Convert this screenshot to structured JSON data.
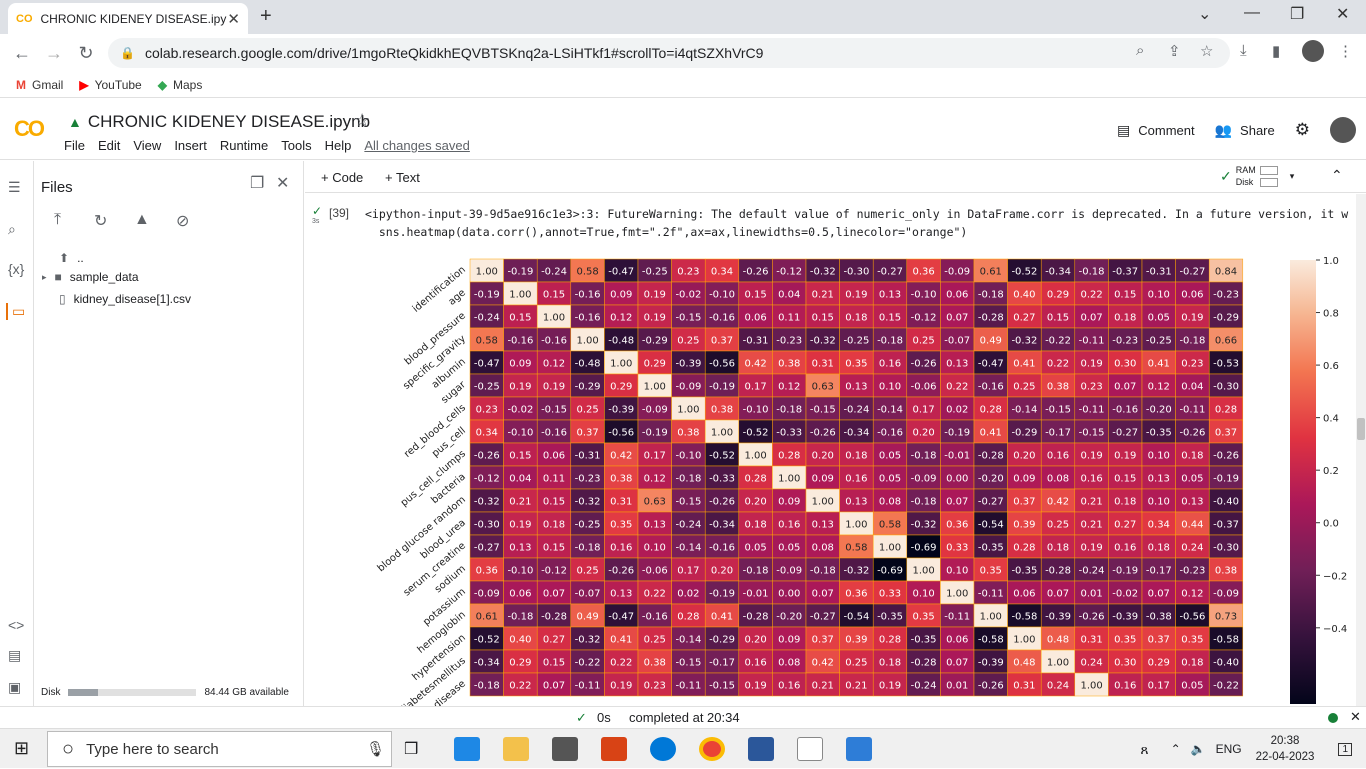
{
  "browser": {
    "tab_title": "CHRONIC KIDENEY DISEASE.ipynb",
    "tab_logo": "CO",
    "url": "colab.research.google.com/drive/1mgoRteQkidkhEQVBTSKnq2a-LSiHTkf1#scrollTo=i4qtSZXhVrC9",
    "bookmarks": [
      {
        "label": "Gmail",
        "icon": "M",
        "color": "#ea4335"
      },
      {
        "label": "YouTube",
        "icon": "▶",
        "color": "#ff0000"
      },
      {
        "label": "Maps",
        "icon": "◆",
        "color": "#34a853"
      }
    ]
  },
  "colab": {
    "logo": "CO",
    "notebook_title": "CHRONIC KIDENEY DISEASE.ipynb",
    "menu": [
      "File",
      "Edit",
      "View",
      "Insert",
      "Runtime",
      "Tools",
      "Help"
    ],
    "save_status": "All changes saved",
    "comment_label": "Comment",
    "share_label": "Share",
    "toolbar": {
      "code_label": "+ Code",
      "text_label": "+ Text",
      "ram_label": "RAM",
      "disk_label": "Disk"
    }
  },
  "files_panel": {
    "title": "Files",
    "tree": [
      {
        "label": "..",
        "type": "up"
      },
      {
        "label": "sample_data",
        "type": "folder"
      },
      {
        "label": "kidney_disease[1].csv",
        "type": "file"
      }
    ],
    "disk_label": "Disk",
    "disk_available": "84.44 GB available",
    "disk_used_fraction": 0.23
  },
  "cell": {
    "exec_count": "[39]",
    "run_time": "3s",
    "warning_line1": "<ipython-input-39-9d5ae916c1e3>:3: FutureWarning: The default value of numeric_only in DataFrame.corr is deprecated. In a future version, it w:",
    "warning_line2": "  sns.heatmap(data.corr(),annot=True,fmt=\".2f\",ax=ax,linewidths=0.5,linecolor=\"orange\")"
  },
  "chart_data": {
    "type": "heatmap",
    "title": "",
    "row_labels": [
      "identification",
      "age",
      "blood_pressure",
      "specific_gravity",
      "albumin",
      "sugar",
      "red_blood_cells",
      "pus_cell",
      "pus_cell_clumps",
      "bacteria",
      "blood glucose random",
      "blood_urea",
      "serum_creatine",
      "sodium",
      "potassium",
      "hemoglobin",
      "hypertension",
      "diabetesmellitus",
      "coronary_artery_disease"
    ],
    "matrix": [
      [
        1.0,
        -0.19,
        -0.24,
        0.58,
        -0.47,
        -0.25,
        0.23,
        0.34,
        -0.26,
        -0.12,
        -0.32,
        -0.3,
        -0.27,
        0.36,
        -0.09,
        0.61,
        -0.52,
        -0.34,
        -0.18,
        -0.37,
        -0.31,
        -0.27,
        0.84
      ],
      [
        -0.19,
        1.0,
        0.15,
        -0.16,
        0.09,
        0.19,
        -0.02,
        -0.1,
        0.15,
        0.04,
        0.21,
        0.19,
        0.13,
        -0.1,
        0.06,
        -0.18,
        0.4,
        0.29,
        0.22,
        0.15,
        0.1,
        0.06,
        -0.23
      ],
      [
        -0.24,
        0.15,
        1.0,
        -0.16,
        0.12,
        0.19,
        -0.15,
        -0.16,
        0.06,
        0.11,
        0.15,
        0.18,
        0.15,
        -0.12,
        0.07,
        -0.28,
        0.27,
        0.15,
        0.07,
        0.18,
        0.05,
        0.19,
        -0.29
      ],
      [
        0.58,
        -0.16,
        -0.16,
        1.0,
        -0.48,
        -0.29,
        0.25,
        0.37,
        -0.31,
        -0.23,
        -0.32,
        -0.25,
        -0.18,
        0.25,
        -0.07,
        0.49,
        -0.32,
        -0.22,
        -0.11,
        -0.23,
        -0.25,
        -0.18,
        0.66
      ],
      [
        -0.47,
        0.09,
        0.12,
        -0.48,
        1.0,
        0.29,
        -0.39,
        -0.56,
        0.42,
        0.38,
        0.31,
        0.35,
        0.16,
        -0.26,
        0.13,
        -0.47,
        0.41,
        0.22,
        0.19,
        0.3,
        0.41,
        0.23,
        -0.53
      ],
      [
        -0.25,
        0.19,
        0.19,
        -0.29,
        0.29,
        1.0,
        -0.09,
        -0.19,
        0.17,
        0.12,
        0.63,
        0.13,
        0.1,
        -0.06,
        0.22,
        -0.16,
        0.25,
        0.38,
        0.23,
        0.07,
        0.12,
        0.04,
        -0.3
      ],
      [
        0.23,
        -0.02,
        -0.15,
        0.25,
        -0.39,
        -0.09,
        1.0,
        0.38,
        -0.1,
        -0.18,
        -0.15,
        -0.24,
        -0.14,
        0.17,
        0.02,
        0.28,
        -0.14,
        -0.15,
        -0.11,
        -0.16,
        -0.2,
        -0.11,
        0.28
      ],
      [
        0.34,
        -0.1,
        -0.16,
        0.37,
        -0.56,
        -0.19,
        0.38,
        1.0,
        -0.52,
        -0.33,
        -0.26,
        -0.34,
        -0.16,
        0.2,
        -0.19,
        0.41,
        -0.29,
        -0.17,
        -0.15,
        -0.27,
        -0.35,
        -0.26,
        0.37
      ],
      [
        -0.26,
        0.15,
        0.06,
        -0.31,
        0.42,
        0.17,
        -0.1,
        -0.52,
        1.0,
        0.28,
        0.2,
        0.18,
        0.05,
        -0.18,
        -0.01,
        -0.28,
        0.2,
        0.16,
        0.19,
        0.19,
        0.1,
        0.18,
        -0.26
      ],
      [
        -0.12,
        0.04,
        0.11,
        -0.23,
        0.38,
        0.12,
        -0.18,
        -0.33,
        0.28,
        1.0,
        0.09,
        0.16,
        0.05,
        -0.09,
        -0.0,
        -0.2,
        0.09,
        0.08,
        0.16,
        0.15,
        0.13,
        0.05,
        -0.19
      ],
      [
        -0.32,
        0.21,
        0.15,
        -0.32,
        0.31,
        0.63,
        -0.15,
        -0.26,
        0.2,
        0.09,
        1.0,
        0.13,
        0.08,
        -0.18,
        0.07,
        -0.27,
        0.37,
        0.42,
        0.21,
        0.18,
        0.1,
        0.13,
        -0.4
      ],
      [
        -0.3,
        0.19,
        0.18,
        -0.25,
        0.35,
        0.13,
        -0.24,
        -0.34,
        0.18,
        0.16,
        0.13,
        1.0,
        0.58,
        -0.32,
        0.36,
        -0.54,
        0.39,
        0.25,
        0.21,
        0.27,
        0.34,
        0.44,
        -0.37
      ],
      [
        -0.27,
        0.13,
        0.15,
        -0.18,
        0.16,
        0.1,
        -0.14,
        -0.16,
        0.05,
        0.05,
        0.08,
        0.58,
        1.0,
        -0.69,
        0.33,
        -0.35,
        0.28,
        0.18,
        0.19,
        0.16,
        0.18,
        0.24,
        -0.3
      ],
      [
        0.36,
        -0.1,
        -0.12,
        0.25,
        -0.26,
        -0.06,
        0.17,
        0.2,
        -0.18,
        -0.09,
        -0.18,
        -0.32,
        -0.69,
        1.0,
        0.1,
        0.35,
        -0.35,
        -0.28,
        -0.24,
        -0.19,
        -0.17,
        -0.23,
        0.38
      ],
      [
        -0.09,
        0.06,
        0.07,
        -0.07,
        0.13,
        0.22,
        0.02,
        -0.19,
        -0.01,
        -0.0,
        0.07,
        0.36,
        0.33,
        0.1,
        1.0,
        -0.11,
        0.06,
        0.07,
        0.01,
        -0.02,
        0.07,
        0.12,
        -0.09
      ],
      [
        0.61,
        -0.18,
        -0.28,
        0.49,
        -0.47,
        -0.16,
        0.28,
        0.41,
        -0.28,
        -0.2,
        -0.27,
        -0.54,
        -0.35,
        0.35,
        -0.11,
        1.0,
        -0.58,
        -0.39,
        -0.26,
        -0.39,
        -0.38,
        -0.56,
        0.73
      ],
      [
        -0.52,
        0.4,
        0.27,
        -0.32,
        0.41,
        0.25,
        -0.14,
        -0.29,
        0.2,
        0.09,
        0.37,
        0.39,
        0.28,
        -0.35,
        0.06,
        -0.58,
        1.0,
        0.48,
        0.31,
        0.35,
        0.37,
        0.35,
        -0.58
      ],
      [
        -0.34,
        0.29,
        0.15,
        -0.22,
        0.22,
        0.38,
        -0.15,
        -0.17,
        0.16,
        0.08,
        0.42,
        0.25,
        0.18,
        -0.28,
        0.07,
        -0.39,
        0.48,
        1.0,
        0.24,
        0.3,
        0.29,
        0.18,
        -0.4
      ],
      [
        -0.18,
        0.22,
        0.07,
        -0.11,
        0.19,
        0.23,
        -0.11,
        -0.15,
        0.19,
        0.16,
        0.21,
        0.21,
        0.19,
        -0.24,
        0.01,
        -0.26,
        0.31,
        0.24,
        1.0,
        0.16,
        0.17,
        0.05,
        -0.22
      ]
    ],
    "colorbar_ticks": [
      "1.0",
      "0.8",
      "0.6",
      "0.4",
      "0.2",
      "0.0",
      "−0.2",
      "−0.4"
    ],
    "vmin": -0.69,
    "vmax": 1.0,
    "colormap": "rocket"
  },
  "statusbar": {
    "check": "✓",
    "duration": "0s",
    "completed": "completed at 20:34"
  },
  "taskbar": {
    "search_placeholder": "Type here to search",
    "lang": "ENG",
    "time": "20:38",
    "date": "22-04-2023",
    "notif_count": "1"
  }
}
